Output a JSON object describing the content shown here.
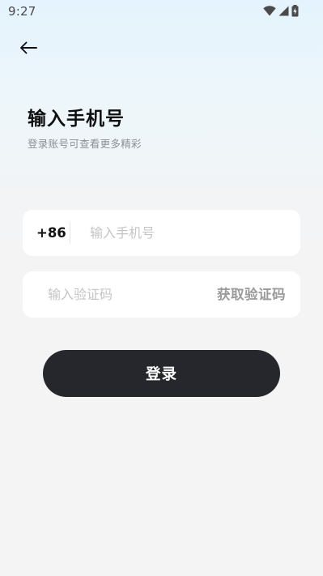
{
  "status_bar": {
    "time": "9:27",
    "icons": [
      "wifi-icon",
      "signal-icon",
      "battery-icon"
    ]
  },
  "header": {
    "back_icon": "arrow-left-icon",
    "title": "输入手机号",
    "subtitle": "登录账号可查看更多精彩"
  },
  "phone_field": {
    "country_code": "+86",
    "placeholder": "输入手机号",
    "value": ""
  },
  "code_field": {
    "placeholder": "输入验证码",
    "value": "",
    "get_code_label": "获取验证码"
  },
  "login_button": {
    "label": "登录"
  },
  "colors": {
    "login_button_bg": "#25272c",
    "placeholder": "#c4c4c4",
    "get_code_text": "#9a9a9a",
    "subtitle_text": "#8a8f96"
  }
}
